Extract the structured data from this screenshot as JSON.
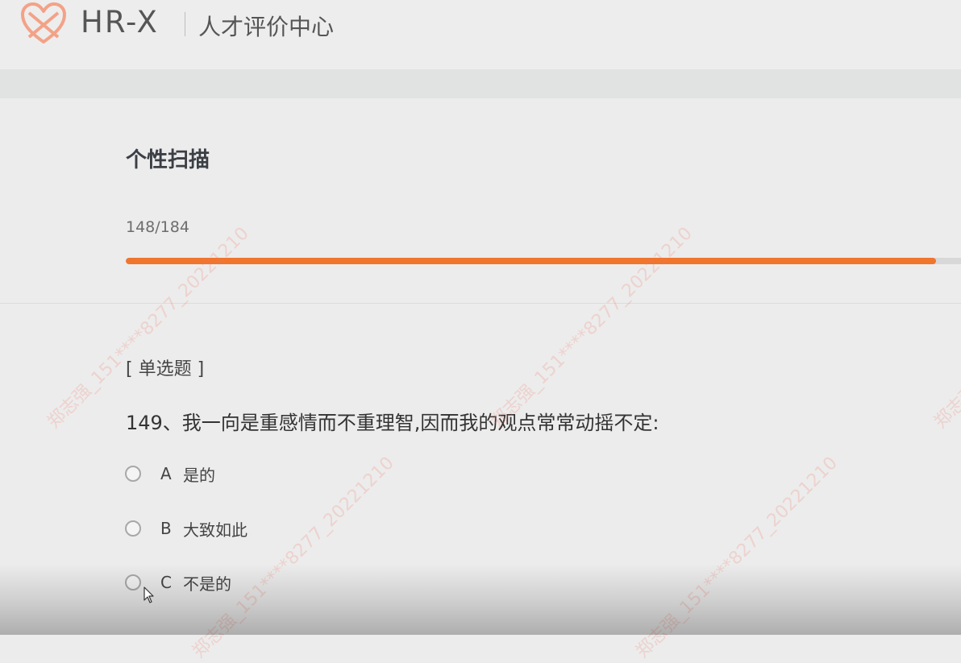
{
  "header": {
    "brand": "HR-X",
    "subtitle": "人才评价中心",
    "logo_icon": "heart-knot-icon"
  },
  "colors": {
    "accent": "#f0752d",
    "logo": "#f3a287"
  },
  "survey": {
    "title": "个性扫描",
    "progress_label": "148/184",
    "progress_current": 148,
    "progress_total": 184,
    "question_type": "[ 单选题 ]",
    "question": "149、我一向是重感情而不重理智,因而我的观点常常动摇不定:",
    "options": [
      {
        "letter": "A",
        "label": "是的"
      },
      {
        "letter": "B",
        "label": "大致如此"
      },
      {
        "letter": "C",
        "label": "不是的"
      }
    ]
  },
  "watermark": "郑志强_151****8277_20221210"
}
